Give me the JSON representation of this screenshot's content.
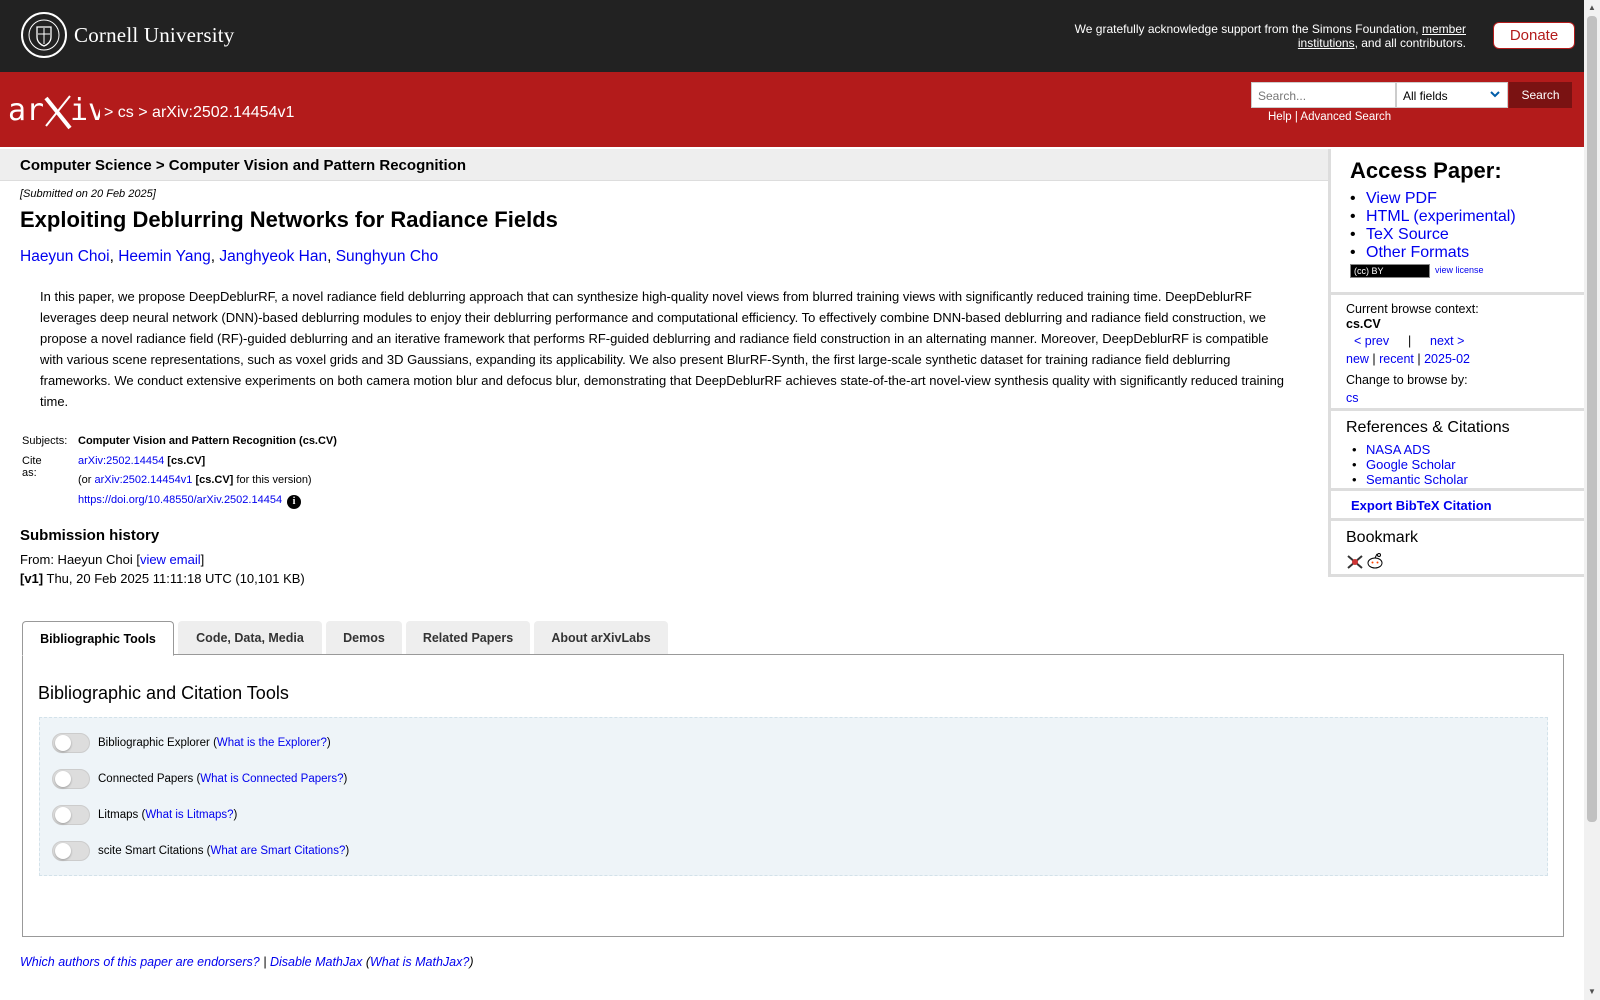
{
  "banner": {
    "university": "Cornell University",
    "ack_text": "We gratefully acknowledge support from the Simons Foundation,",
    "ack_link": "member institutions",
    "ack_tail": ", and all contributors.",
    "donate": "Donate"
  },
  "header": {
    "crumb_sep": ">",
    "crumb_cs": "cs",
    "crumb_paper": "arXiv:2502.14454v1",
    "search_placeholder": "Search...",
    "search_field": "All fields",
    "search_button": "Search",
    "help": "Help",
    "advanced": "Advanced Search"
  },
  "subject_bar": "Computer Science > Computer Vision and Pattern Recognition",
  "paper": {
    "submitted": "[Submitted on 20 Feb 2025]",
    "title": "Exploiting Deblurring Networks for Radiance Fields",
    "authors": [
      "Haeyun Choi",
      "Heemin Yang",
      "Janghyeok Han",
      "Sunghyun Cho"
    ],
    "abstract": "In this paper, we propose DeepDeblurRF, a novel radiance field deblurring approach that can synthesize high-quality novel views from blurred training views with significantly reduced training time. DeepDeblurRF leverages deep neural network (DNN)-based deblurring modules to enjoy their deblurring performance and computational efficiency. To effectively combine DNN-based deblurring and radiance field construction, we propose a novel radiance field (RF)-guided deblurring and an iterative framework that performs RF-guided deblurring and radiance field construction in an alternating manner. Moreover, DeepDeblurRF is compatible with various scene representations, such as voxel grids and 3D Gaussians, expanding its applicability. We also present BlurRF-Synth, the first large-scale synthetic dataset for training radiance field deblurring frameworks. We conduct extensive experiments on both camera motion blur and defocus blur, demonstrating that DeepDeblurRF achieves state-of-the-art novel-view synthesis quality with significantly reduced training time."
  },
  "meta": {
    "subjects_label": "Subjects:",
    "subjects_value": "Computer Vision and Pattern Recognition (cs.CV)",
    "cite_label": "Cite as:",
    "cite_id": "arXiv:2502.14454",
    "cite_cat": "[cs.CV]",
    "or_prefix": "(or",
    "version_id": "arXiv:2502.14454v1",
    "version_cat": "[cs.CV]",
    "version_suffix": "for this version)",
    "doi": "https://doi.org/10.48550/arXiv.2502.14454",
    "info_glyph": "i"
  },
  "history": {
    "title": "Submission history",
    "from_prefix": "From: Haeyun Choi [",
    "view_email": "view email",
    "from_suffix": "]",
    "v1_label": "[v1]",
    "v1_text": "Thu, 20 Feb 2025 11:11:18 UTC (10,101 KB)"
  },
  "sidebar": {
    "access_title": "Access Paper:",
    "access_links": [
      "View PDF",
      "HTML (experimental)",
      "TeX Source",
      "Other Formats"
    ],
    "license_badge": "(cc) BY",
    "view_license": "view license",
    "browse_context_label": "Current browse context:",
    "browse_context": "cs.CV",
    "prev": "< prev",
    "pipe": "|",
    "next": "next >",
    "new": "new",
    "recent": "recent",
    "month": "2025-02",
    "change_browse": "Change to browse by:",
    "browse_cs": "cs",
    "refs_title": "References & Citations",
    "refs_links": [
      "NASA ADS",
      "Google Scholar",
      "Semantic Scholar"
    ],
    "export": "Export BibTeX Citation",
    "bookmark_title": "Bookmark"
  },
  "tabs": [
    "Bibliographic Tools",
    "Code, Data, Media",
    "Demos",
    "Related Papers",
    "About arXivLabs"
  ],
  "tools": {
    "title": "Bibliographic and Citation Tools",
    "items": [
      {
        "name": "Bibliographic Explorer",
        "link": "What is the Explorer?"
      },
      {
        "name": "Connected Papers",
        "link": "What is Connected Papers?"
      },
      {
        "name": "Litmaps",
        "link": "What is Litmaps?"
      },
      {
        "name": "scite Smart Citations",
        "link": "What are Smart Citations?"
      }
    ]
  },
  "footer": {
    "endorsers": "Which authors of this paper are endorsers?",
    "sep": "|",
    "disable_mathjax": "Disable MathJax",
    "what_mathjax": "What is MathJax?"
  },
  "colors": {
    "arxiv_red": "#b31b1b",
    "banner": "#222222",
    "link": "#0000ee"
  }
}
